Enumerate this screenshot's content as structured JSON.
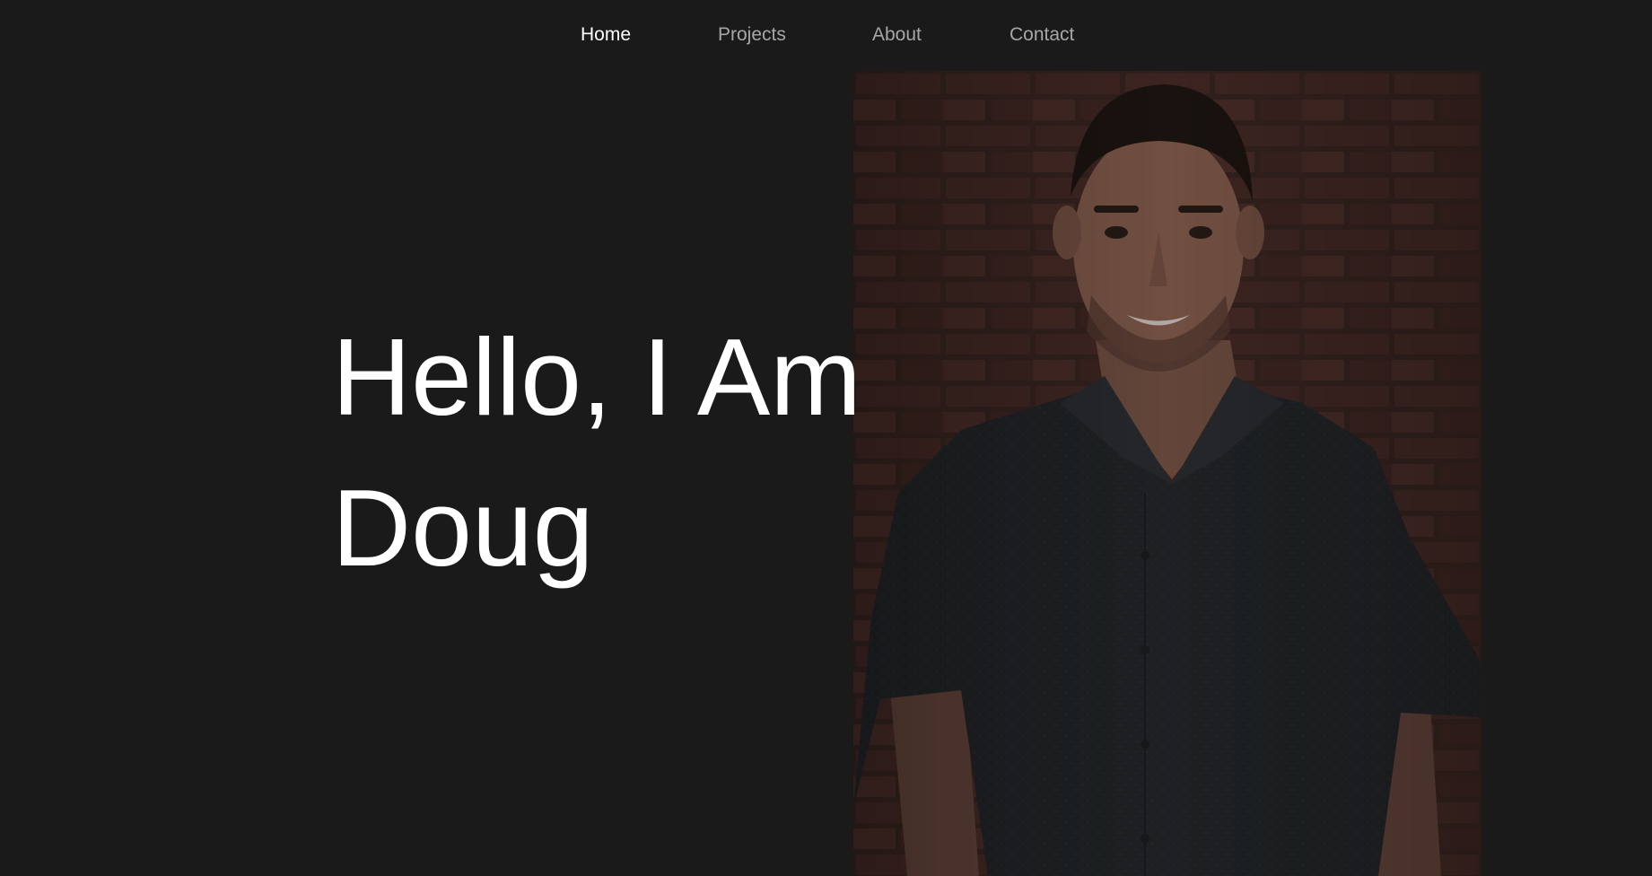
{
  "colors": {
    "background": "#1a1a1a",
    "nav_active": "#ffffff",
    "nav_inactive": "#a7a7a7",
    "heading": "#ffffff"
  },
  "nav": {
    "items": [
      {
        "label": "Home",
        "active": true
      },
      {
        "label": "Projects",
        "active": false
      },
      {
        "label": "About",
        "active": false
      },
      {
        "label": "Contact",
        "active": false
      }
    ]
  },
  "hero": {
    "line1": "Hello, I Am",
    "line2": "Doug"
  },
  "portrait": {
    "subject": "person-photo",
    "background": "brick-wall"
  }
}
